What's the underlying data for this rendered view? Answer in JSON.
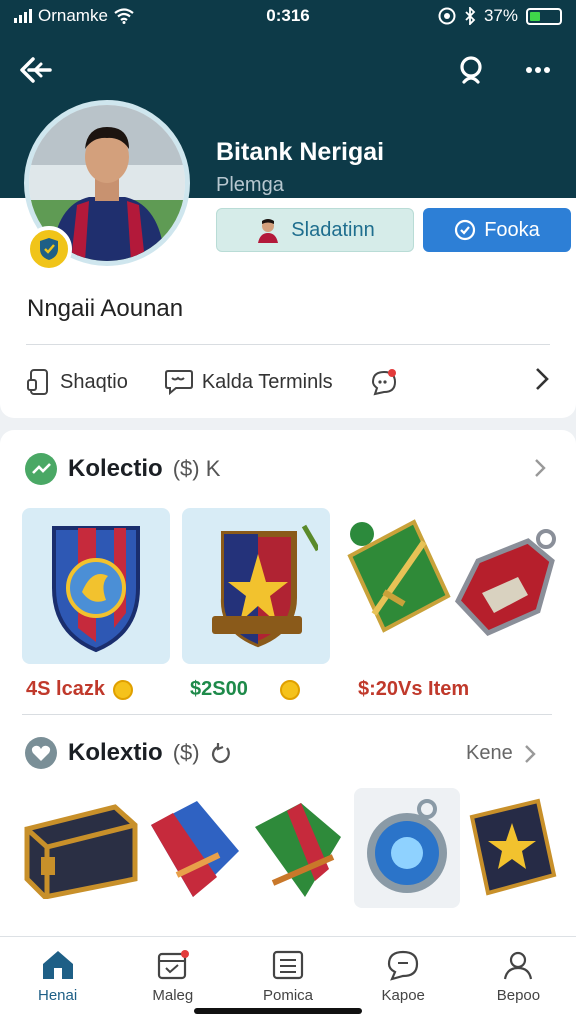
{
  "status_bar": {
    "carrier": "Ornamke",
    "time": "0:316",
    "battery_text": "37%",
    "battery_level": 0.37
  },
  "profile": {
    "name": "Bitank Nerigai",
    "role": "Plemga",
    "display_name": "Nngaii Aounan",
    "secondary_button": "Sladatinn",
    "primary_button": "Fooka",
    "info_items": [
      "Shaqtio",
      "Kalda Terminls"
    ]
  },
  "collections": [
    {
      "title": "Kolectio",
      "subtitle": "($) K",
      "link": "",
      "prices": [
        "4S lcazk",
        "$2S00",
        "$:20Vs Item"
      ]
    },
    {
      "title": "Kolextio",
      "subtitle": "($)",
      "link": "Kene",
      "prices": []
    }
  ],
  "bottom_nav": [
    {
      "label": "Henai",
      "icon": "home-icon",
      "active": true
    },
    {
      "label": "Maleg",
      "icon": "calendar-icon",
      "active": false
    },
    {
      "label": "Pomica",
      "icon": "list-icon",
      "active": false
    },
    {
      "label": "Kapoe",
      "icon": "chat-icon",
      "active": false
    },
    {
      "label": "Bepoo",
      "icon": "profile-icon",
      "active": false
    }
  ],
  "colors": {
    "header": "#0d3a48",
    "accent": "#2d7fd6",
    "active_nav": "#1e5f86",
    "price_red": "#c0392b",
    "price_green": "#1e8a4a"
  }
}
